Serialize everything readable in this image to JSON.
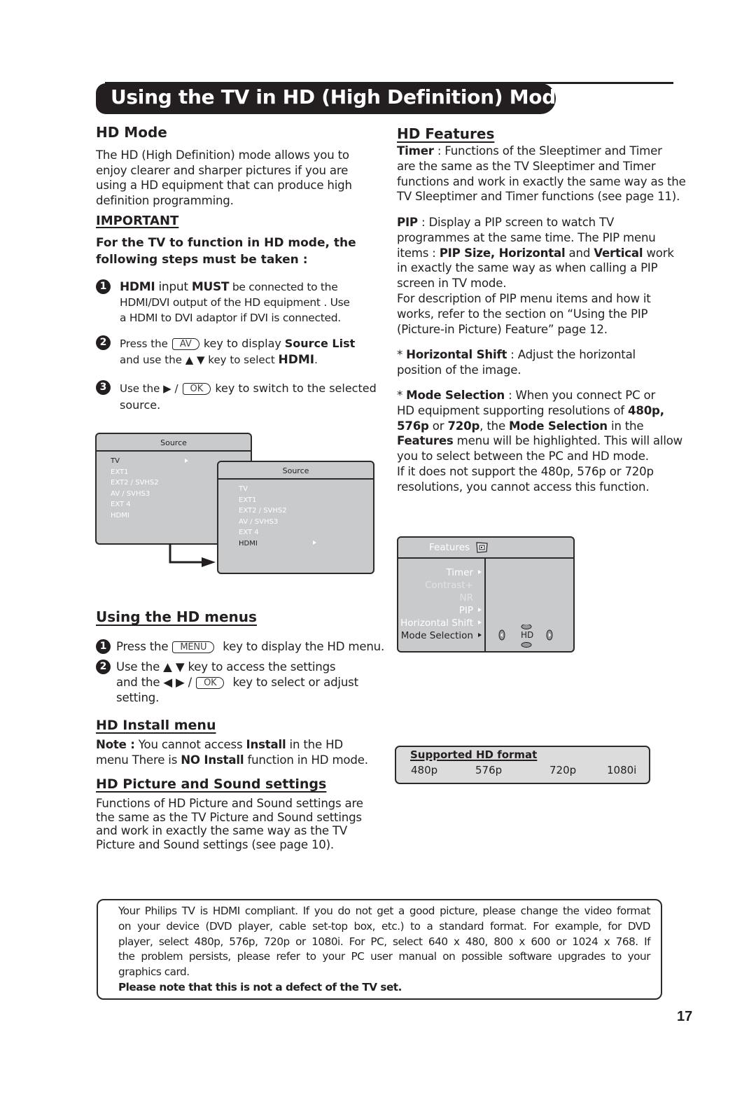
{
  "page": {
    "title": "Using the TV in HD (High Definition) Mode",
    "page_number": "17"
  },
  "hd_mode": {
    "heading": "HD Mode",
    "paragraph": "The HD (High Definition) mode allows you to enjoy clearer and sharper pictures if you are using a HD equipment that can produce high definition programming.",
    "lines": [
      "The HD (High Definition) mode allows you to",
      "enjoy clearer and sharper pictures if you are",
      "using a HD equipment that can produce high",
      "definition programming."
    ],
    "important_label": "IMPORTANT",
    "important_text_lines": [
      "For the TV to function in HD mode, the",
      "following steps must be taken :"
    ],
    "steps": [
      {
        "number": "1",
        "lines": [
          {
            "parts": [
              {
                "t": "HDMI",
                "b": true
              },
              {
                "t": " input "
              },
              {
                "t": "MUST",
                "b": true
              },
              {
                "t": " be connected to the"
              }
            ]
          },
          {
            "parts": [
              {
                "t": "HDMI/DVI output of the HD equipment . Use"
              }
            ]
          },
          {
            "parts": [
              {
                "t": "a HDMI to DVI  adaptor if DVI is connected."
              }
            ]
          }
        ]
      },
      {
        "number": "2",
        "line1_before": "Press the",
        "key": "AV",
        "line1_after": "key to display",
        "line1_bold": "Source List",
        "line2_before": "and use the ▲ ▼ key to select",
        "line2_bold": "HDMI",
        "line2_end": "."
      },
      {
        "number": "3",
        "line1_before": "Use the ▶ /",
        "key": "OK",
        "line1_after": "key to switch to the selected",
        "line2": "source."
      }
    ]
  },
  "source_menus": {
    "menu1": {
      "title": "Source",
      "items": [
        "TV",
        "EXT1",
        "EXT2 / SVHS2",
        "AV / SVHS3",
        "EXT 4",
        "HDMI"
      ],
      "selected": "TV"
    },
    "menu2": {
      "title": "Source",
      "items": [
        "TV",
        "EXT1",
        "EXT2 / SVHS2",
        "AV / SVHS3",
        "EXT 4",
        "HDMI"
      ],
      "selected": "HDMI"
    }
  },
  "hd_menus": {
    "heading": "Using the HD menus",
    "step1": {
      "number": "1",
      "before": "Press the",
      "key": "MENU",
      "after": "key to display the HD menu."
    },
    "step2": {
      "number": "2",
      "line1": "Use the ▲ ▼ key to access the settings",
      "line2_before": "and the ◀  ▶ /",
      "key": "OK",
      "line2_after": "key to select or adjust",
      "line3": "setting."
    }
  },
  "hd_install": {
    "heading": "HD Install menu",
    "line1": [
      {
        "t": "Note :",
        "b": true
      },
      {
        "t": " You cannot access "
      },
      {
        "t": "Install",
        "b": true
      },
      {
        "t": " in the HD"
      }
    ],
    "line2": [
      {
        "t": "menu There is "
      },
      {
        "t": "NO Install",
        "b": true
      },
      {
        "t": " function in HD mode."
      }
    ]
  },
  "hd_picture_sound": {
    "heading": "HD Picture and Sound settings",
    "lines": [
      "Functions of HD Picture and Sound settings are",
      "the same as the TV Picture and Sound settings",
      "and work in exactly the same way as the TV",
      "Picture and Sound settings (see page 10)."
    ]
  },
  "hd_features": {
    "heading": "HD Features",
    "timer": {
      "label": "Timer",
      "lines": [
        " : Functions of the Sleeptimer and Timer",
        "are the same as the TV Sleeptimer and Timer",
        "functions and work in exactly the same way as the",
        "TV Sleeptimer and Timer functions (see page 11)."
      ]
    },
    "pip": {
      "label": "PIP",
      "line1": " : Display a PIP screen to watch TV",
      "line2": "programmes at the same time. The PIP menu",
      "line3": [
        {
          "t": "items : "
        },
        {
          "t": "PIP Size, Horizontal",
          "b": true
        },
        {
          "t": " and "
        },
        {
          "t": "Vertical",
          "b": true
        },
        {
          "t": " work"
        }
      ],
      "line4": "in exactly the same way as when calling a PIP",
      "line5": "screen in TV mode.",
      "line6": "For description of PIP menu items and how it",
      "line7": "works, refer to the section on “Using the  PIP",
      "line8": "(Picture-in Picture) Feature” page 12."
    },
    "horizontal_shift": {
      "line1": [
        {
          "t": "* "
        },
        {
          "t": "Horizontal Shift",
          "b": true
        },
        {
          "t": "  : Adjust the horizontal"
        }
      ],
      "line2": "position of the image."
    },
    "mode_selection": {
      "line1": [
        {
          "t": "* "
        },
        {
          "t": "Mode Selection",
          "b": true
        },
        {
          "t": " : When you connect PC or"
        }
      ],
      "line2": [
        {
          "t": "HD equipment supporting resolutions of "
        },
        {
          "t": "480p,",
          "b": true
        }
      ],
      "line3": [
        {
          "t": "576p",
          "b": true
        },
        {
          "t": " or "
        },
        {
          "t": "720p",
          "b": true
        },
        {
          "t": ", the "
        },
        {
          "t": "Mode Selection",
          "b": true
        },
        {
          "t": " in the"
        }
      ],
      "line4": [
        {
          "t": "Features",
          "b": true
        },
        {
          "t": " menu will be highlighted. This will allow"
        }
      ],
      "line5": "you to select between the PC and HD mode.",
      "line6": "If it does not support the 480p, 576p or 720p",
      "line7": "resolutions, you cannot access this function."
    }
  },
  "features_menu": {
    "title": "Features",
    "title_icon": "features-tv-icon",
    "items": [
      {
        "label": "Timer",
        "style": "normal",
        "arrow": true
      },
      {
        "label": "Contrast+",
        "style": "dim",
        "arrow": false
      },
      {
        "label": "NR",
        "style": "dim",
        "arrow": false
      },
      {
        "label": "PIP",
        "style": "normal",
        "arrow": true
      },
      {
        "label": "Horizontal Shift",
        "style": "normal",
        "arrow": true
      },
      {
        "label": "Mode Selection",
        "style": "selected",
        "arrow": true
      }
    ],
    "value": "HD"
  },
  "supported_formats": {
    "heading": "Supported HD format",
    "formats": [
      "480p",
      "576p",
      "720p",
      "1080i"
    ]
  },
  "note_box": {
    "lines": [
      "Your Philips TV is HDMI compliant. If you do not get a good picture, please change the video format",
      "on your device (DVD player, cable set-top box, etc.) to a standard format. For example, for DVD",
      "player, select 480p, 576p, 720p or 1080i. For PC, select 640 x 480, 800 x 600 or 1024 x 768. If",
      "the problem persists, please refer to your PC user manual on possible software upgrades to your",
      "graphics card."
    ],
    "bold_line": "Please note that this is not a defect of the TV set."
  }
}
